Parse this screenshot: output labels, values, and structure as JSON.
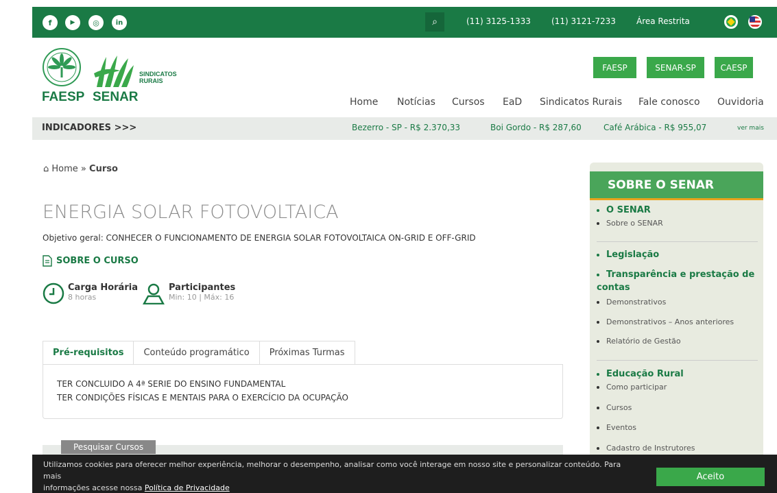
{
  "topbar": {
    "social": [
      {
        "name": "facebook-icon",
        "glyph": "f"
      },
      {
        "name": "youtube-icon",
        "glyph": "▶"
      },
      {
        "name": "instagram-icon",
        "glyph": "◎"
      },
      {
        "name": "linkedin-icon",
        "glyph": "in"
      }
    ],
    "phone1": "(11) 3125-1333",
    "phone2": "(11) 3121-7233",
    "restricted": "Área Restrita",
    "search_icon": "⌕"
  },
  "header": {
    "logo1": "FAESP",
    "logo2": "SENAR",
    "logo3_line1": "SINDICATOS",
    "logo3_line2": "RURAIS",
    "buttons": [
      "FAESP",
      "SENAR-SP",
      "CAESP"
    ],
    "nav": [
      "Home",
      "Notícias",
      "Cursos",
      "EaD",
      "Sindicatos Rurais",
      "Fale conosco",
      "Ouvidoria"
    ]
  },
  "indicators": {
    "label": "INDICADORES >>>",
    "items": [
      "Bezerro - SP - R$ 2.370,33",
      "Boi Gordo - R$ 287,60",
      "Café Arábica - R$ 955,07"
    ],
    "more": "ver mais"
  },
  "breadcrumb": {
    "home": "Home »",
    "current": "Curso"
  },
  "course": {
    "title": "ENERGIA SOLAR FOTOVOLTAICA",
    "objective": "Objetivo geral: CONHECER O FUNCIONAMENTO DE ENERGIA SOLAR FOTOVOLTAICA ON-GRID E OFF-GRID",
    "about_label": "SOBRE O CURSO",
    "hours_title": "Carga Horária",
    "hours_value": "8 horas",
    "participants_title": "Participantes",
    "participants_value": "Min: 10 | Máx: 16"
  },
  "tabs": [
    "Pré-requisitos",
    "Conteúdo programático",
    "Próximas Turmas"
  ],
  "prereq": [
    "TER CONCLUIDO A 4ª SERIE DO ENSINO FUNDAMENTAL",
    "TER CONDIÇÕES FÍSICAS E MENTAIS PARA O EXERCÍCIO DA OCUPAÇÃO"
  ],
  "search_courses": "Pesquisar Cursos",
  "sidebar": {
    "title": "SOBRE O SENAR",
    "items": [
      "O SENAR",
      "Sobre o SENAR",
      "Legislação",
      "Transparência e prestação de",
      "contas",
      "Demonstrativos",
      "Demonstrativos – Anos anteriores",
      "Relatório de Gestão",
      "Educação Rural",
      "Como participar",
      "Cursos",
      "Eventos",
      "Cadastro de Instrutores"
    ]
  },
  "cookie": {
    "text1": "Utilizamos cookies para oferecer melhor experiência, melhorar o desempenho, analisar como você interage em nosso site e personalizar conteúdo. Para mais",
    "text2": "informações acesse nossa ",
    "link": "Política de Privacidade",
    "accept": "Aceito"
  }
}
